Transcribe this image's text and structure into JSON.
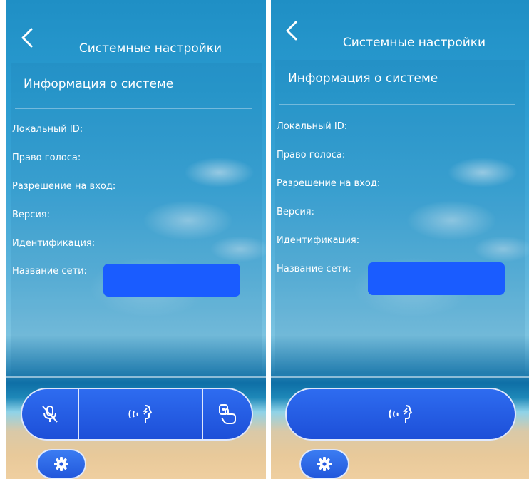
{
  "screens": [
    {
      "title": "Системные настройки",
      "section_title": "Информация о системе",
      "fields": [
        {
          "label": "Локальный ID:"
        },
        {
          "label": "Право голоса:"
        },
        {
          "label": "Разрешение на вход:"
        },
        {
          "label": "Версия:"
        },
        {
          "label": "Идентификация:"
        },
        {
          "label": "Название сети:"
        }
      ],
      "callbar": {
        "buttons": [
          "mute-mic-icon",
          "talk-icon",
          "unlock-hand-icon"
        ]
      },
      "settings_icon": "gear-icon"
    },
    {
      "title": "Системные настройки",
      "section_title": "Информация о системе",
      "fields": [
        {
          "label": "Локальный ID:"
        },
        {
          "label": "Право голоса:"
        },
        {
          "label": "Разрешение на вход:"
        },
        {
          "label": "Версия:"
        },
        {
          "label": "Идентификация:"
        },
        {
          "label": "Название сети:"
        }
      ],
      "callbar": {
        "buttons": [
          "talk-icon"
        ]
      },
      "settings_icon": "gear-icon"
    }
  ],
  "colors": {
    "button_blue": "#2558e0",
    "redaction_blue": "#1a5cff",
    "text": "#ffffff"
  }
}
